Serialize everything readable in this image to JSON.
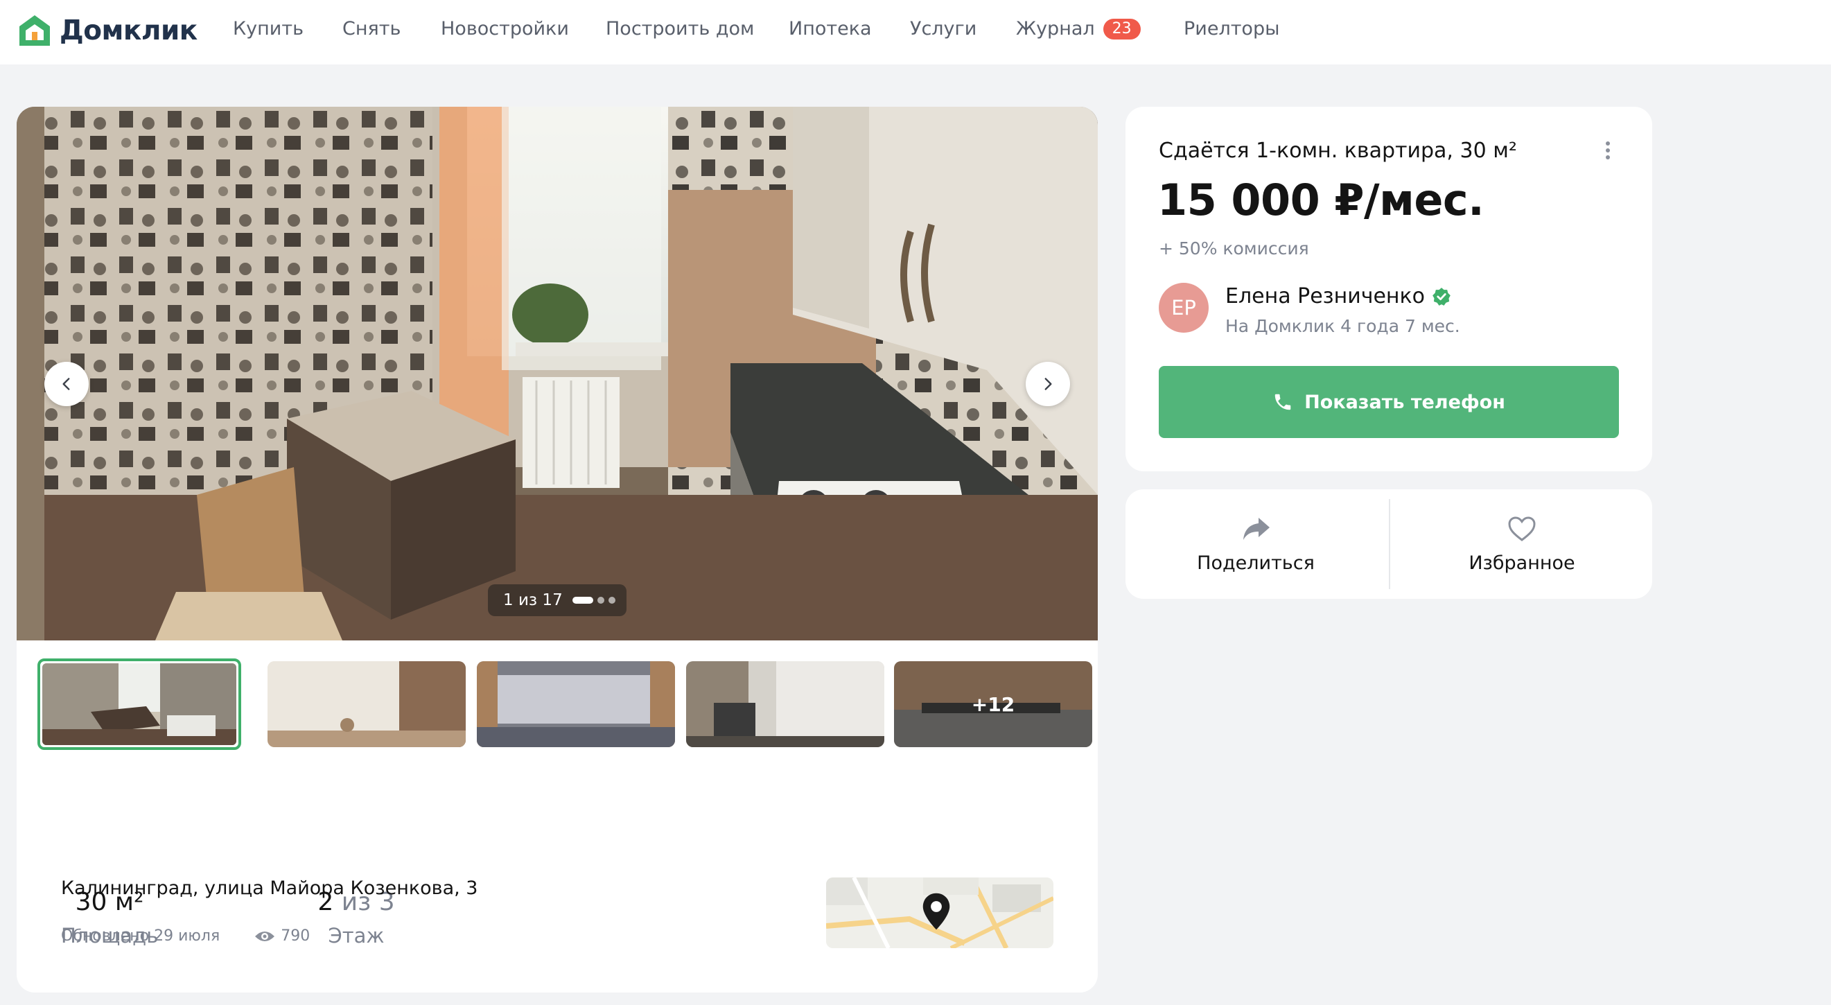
{
  "brand": {
    "name": "Домклик",
    "accent": "#52b57a"
  },
  "nav": {
    "items": [
      {
        "label": "Купить"
      },
      {
        "label": "Снять"
      },
      {
        "label": "Новостройки"
      },
      {
        "label": "Построить дом"
      },
      {
        "label": "Ипотека"
      },
      {
        "label": "Услуги"
      },
      {
        "label": "Журнал",
        "badge": "23"
      },
      {
        "label": "Риелторы"
      }
    ]
  },
  "gallery": {
    "counter": "1 из 17",
    "more_photos": "+12"
  },
  "facts": [
    {
      "value": "30 м²",
      "label": "Площадь"
    },
    {
      "value_main": "2",
      "value_rest": "из 3",
      "label": "Этаж"
    }
  ],
  "listing": {
    "address": "Калининград, улица Майора Козенкова, 3",
    "updated": "Обновлено 29 июля",
    "views": "790"
  },
  "offer": {
    "title": "Сдаётся 1-комн. квартира, 30 м²",
    "price": "15 000 ₽/мес.",
    "commission": "+ 50% комиссия"
  },
  "agent": {
    "initials": "ЕР",
    "name": "Елена Резниченко",
    "since": "На Домклик 4 года 7 мес."
  },
  "buttons": {
    "show_phone": "Показать телефон",
    "share": "Поделиться",
    "favorite": "Избранное"
  }
}
